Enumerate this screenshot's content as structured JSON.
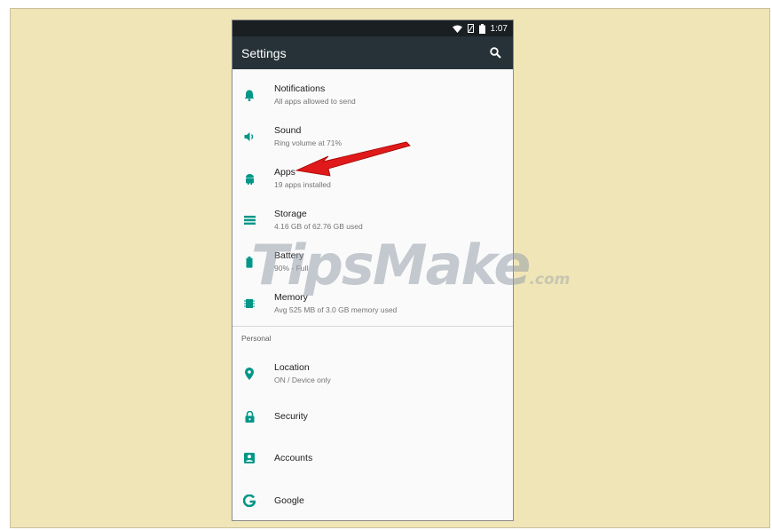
{
  "status_bar": {
    "time": "1:07",
    "icons": [
      "wifi-icon",
      "signal-icon",
      "battery-icon"
    ]
  },
  "app_bar": {
    "title": "Settings",
    "search_icon": "search-icon"
  },
  "items": [
    {
      "title": "Notifications",
      "subtitle": "All apps allowed to send",
      "icon": "bell-icon"
    },
    {
      "title": "Sound",
      "subtitle": "Ring volume at 71%",
      "icon": "speaker-icon"
    },
    {
      "title": "Apps",
      "subtitle": "19 apps installed",
      "icon": "android-icon"
    },
    {
      "title": "Storage",
      "subtitle": "4.16 GB of 62.76 GB used",
      "icon": "storage-icon"
    },
    {
      "title": "Battery",
      "subtitle": "90% - Full",
      "icon": "battery-icon"
    },
    {
      "title": "Memory",
      "subtitle": "Avg 525 MB of 3.0 GB memory used",
      "icon": "memory-icon"
    }
  ],
  "personal": {
    "header": "Personal",
    "items": [
      {
        "title": "Location",
        "subtitle": "ON / Device only",
        "icon": "location-pin-icon"
      },
      {
        "title": "Security",
        "subtitle": "",
        "icon": "lock-icon"
      },
      {
        "title": "Accounts",
        "subtitle": "",
        "icon": "account-icon"
      },
      {
        "title": "Google",
        "subtitle": "",
        "icon": "google-icon"
      }
    ]
  },
  "watermark": {
    "main": "TipsMake",
    "domain": ".com"
  },
  "colors": {
    "accent": "#009688",
    "app_bar": "#263238",
    "status_bar": "#1a1f22",
    "arrow": "#e01a1a",
    "background": "#f0e5b6"
  }
}
